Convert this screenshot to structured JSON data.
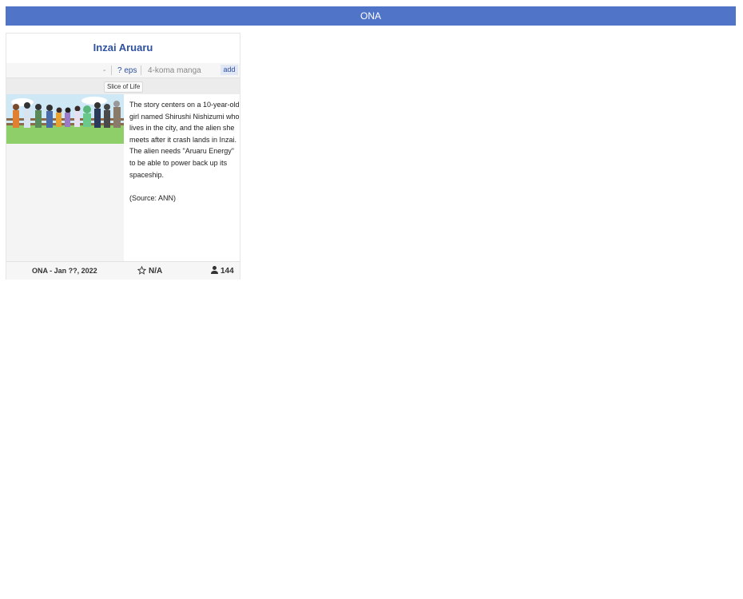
{
  "section": {
    "title": "ONA"
  },
  "card": {
    "title": "Inzai Aruaru",
    "studio": "-",
    "episodes": "? eps",
    "source": "4-koma manga",
    "add_label": "add",
    "genres": [
      "Slice of Life"
    ],
    "synopsis": [
      "The story centers on a 10-year-old girl named Shirushi Nishizumi who lives in the city, and the alien she meets after it crash lands in Inzai. The alien needs \"Aruaru Energy\" to be able to power back up its spaceship.",
      "(Source: ANN)"
    ],
    "footer": {
      "info": "ONA - Jan ??, 2022",
      "score": "N/A",
      "members": "144"
    },
    "icons": {
      "score": "star-outline-icon",
      "members": "user-icon"
    }
  },
  "colors": {
    "header_bg": "#4f74c8",
    "link": "#2e51a2"
  }
}
